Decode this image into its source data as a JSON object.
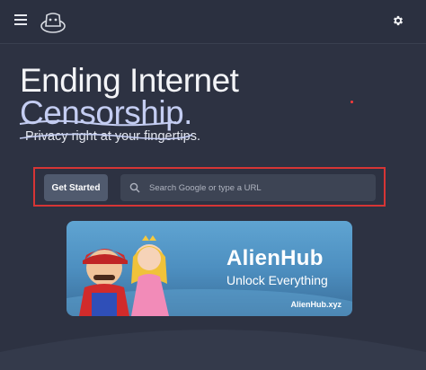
{
  "header": {
    "menu_icon": "hamburger-menu-icon",
    "logo_icon": "alien-hat-logo-icon",
    "settings_icon": "gear-icon"
  },
  "hero": {
    "title_line1": "Ending Internet",
    "title_line2": "Censorship.",
    "subtitle": "Privacy right at your fingertips."
  },
  "actions": {
    "get_started_label": "Get Started",
    "search_placeholder": "Search Google or type a URL",
    "search_value": "",
    "search_icon": "search-icon"
  },
  "banner": {
    "title": "AlienHub",
    "subtitle": "Unlock Everything",
    "url": "AlienHub.xyz"
  },
  "colors": {
    "background": "#2d3242",
    "title_accent": "#c4cdf2",
    "highlight_border": "#d63535",
    "button_bg": "#505a6e"
  }
}
